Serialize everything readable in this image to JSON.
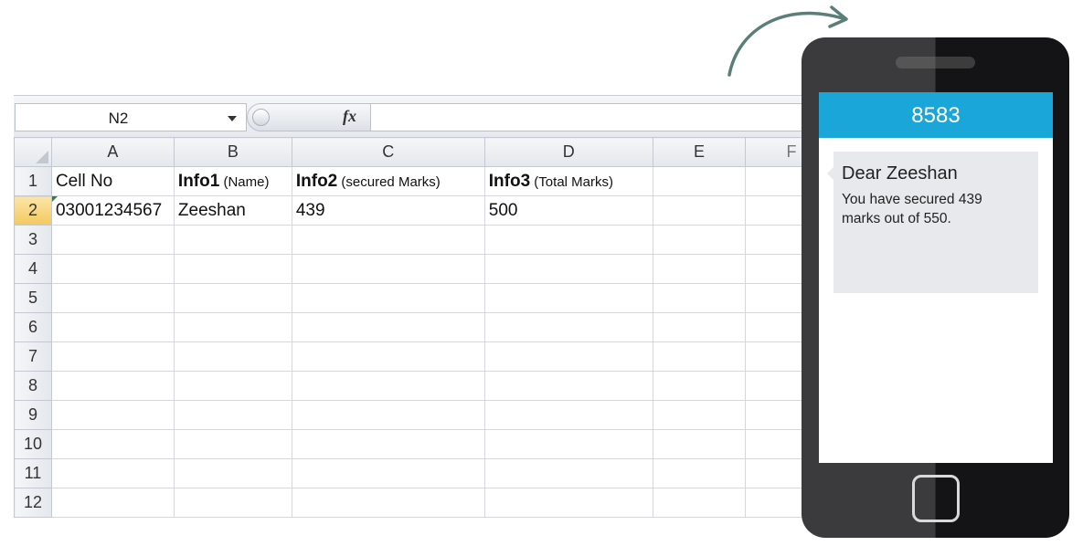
{
  "spreadsheet": {
    "name_box": "N2",
    "fx_label": "fx",
    "columns": [
      "A",
      "B",
      "C",
      "D",
      "E",
      "F"
    ],
    "rows": [
      "1",
      "2",
      "3",
      "4",
      "5",
      "6",
      "7",
      "8",
      "9",
      "10",
      "11",
      "12"
    ],
    "header_row": {
      "a": "Cell No",
      "b_bold": "Info1",
      "b_small": " (Name)",
      "c_bold": "Info2",
      "c_small": " (secured Marks)",
      "d_bold": "Info3",
      "d_small": " (Total Marks)"
    },
    "data_row": {
      "a": "03001234567",
      "b": "Zeeshan",
      "c": "439",
      "d": "500"
    }
  },
  "phone": {
    "sender": "8583",
    "message_title": "Dear Zeeshan",
    "message_body": "You have secured 439 marks out of 550."
  },
  "colors": {
    "sms_header": "#1aa6d9",
    "active_row_header": "#f3c95e",
    "arrow": "#5a7f78"
  }
}
